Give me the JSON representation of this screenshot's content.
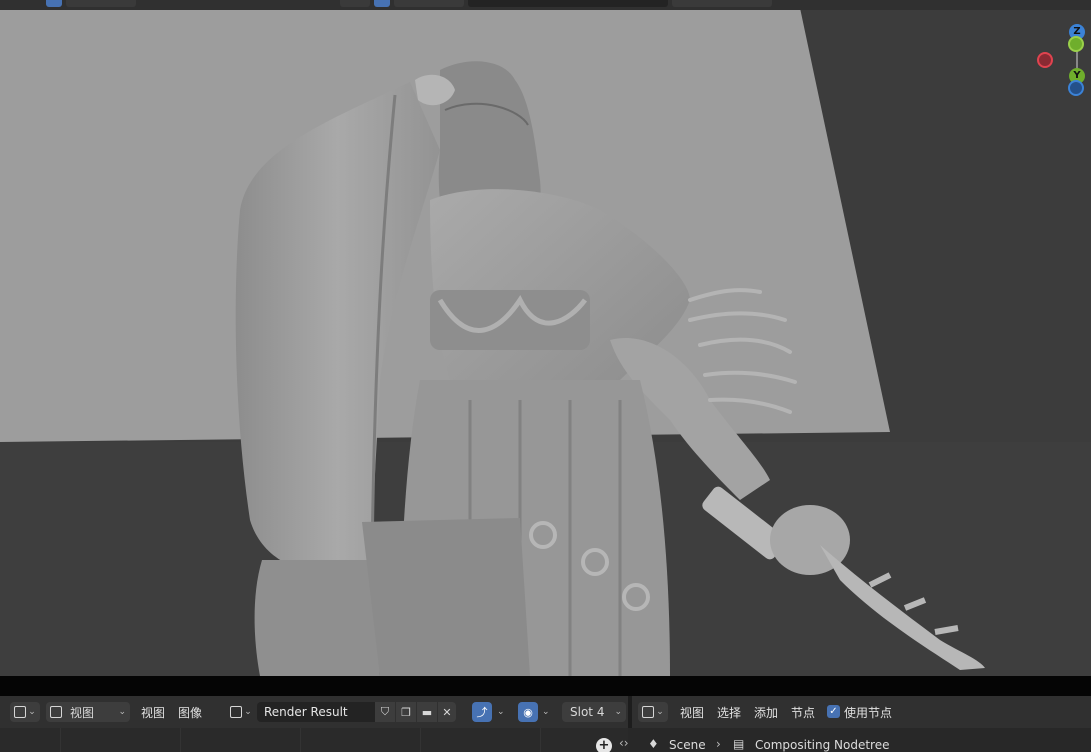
{
  "viewport": {
    "gizmo": {
      "z_label": "Z",
      "y_label": "Y",
      "x_color": "#e0434f",
      "y_color": "#6fae2c",
      "z_color": "#3b82d6"
    }
  },
  "image_editor": {
    "editor_type_icon": "image-editor-icon",
    "view_mode": "视图",
    "menus": [
      "视图",
      "图像"
    ],
    "image_name": "Render Result",
    "slot": "Slot 4"
  },
  "compositor": {
    "editor_type_icon": "node-editor-icon",
    "menus": [
      "视图",
      "选择",
      "添加",
      "节点"
    ],
    "use_nodes_label": "使用节点",
    "use_nodes_checked": true,
    "breadcrumb": {
      "scene": "Scene",
      "nodetree": "Compositing Nodetree"
    }
  },
  "colors": {
    "accent": "#4772b3",
    "header_bg": "#303030",
    "viewport_bg": "#3c3c3c"
  }
}
